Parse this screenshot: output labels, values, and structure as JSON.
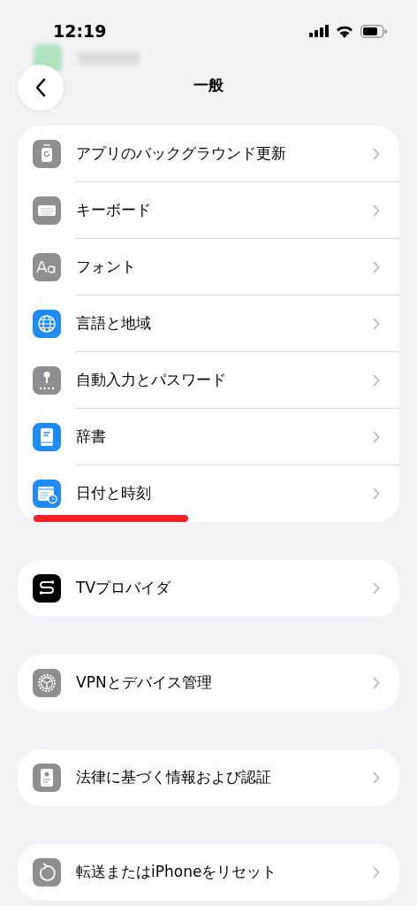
{
  "status_bar": {
    "time": "12:19"
  },
  "nav": {
    "title": "一般"
  },
  "groups": [
    {
      "items": [
        {
          "label": "アプリのバックグラウンド更新",
          "underlined": false
        },
        {
          "label": "キーボード",
          "underlined": false
        },
        {
          "label": "フォント",
          "underlined": false
        },
        {
          "label": "言語と地域",
          "underlined": false
        },
        {
          "label": "自動入力とパスワード",
          "underlined": false
        },
        {
          "label": "辞書",
          "underlined": false
        },
        {
          "label": "日付と時刻",
          "underlined": true
        }
      ]
    },
    {
      "items": [
        {
          "label": "TVプロバイダ",
          "underlined": false
        }
      ]
    },
    {
      "items": [
        {
          "label": "VPNとデバイス管理",
          "underlined": false
        }
      ]
    },
    {
      "items": [
        {
          "label": "法律に基づく情報および認証",
          "underlined": false
        }
      ]
    },
    {
      "items": [
        {
          "label": "転送またはiPhoneをリセット",
          "underlined": false
        }
      ]
    }
  ]
}
